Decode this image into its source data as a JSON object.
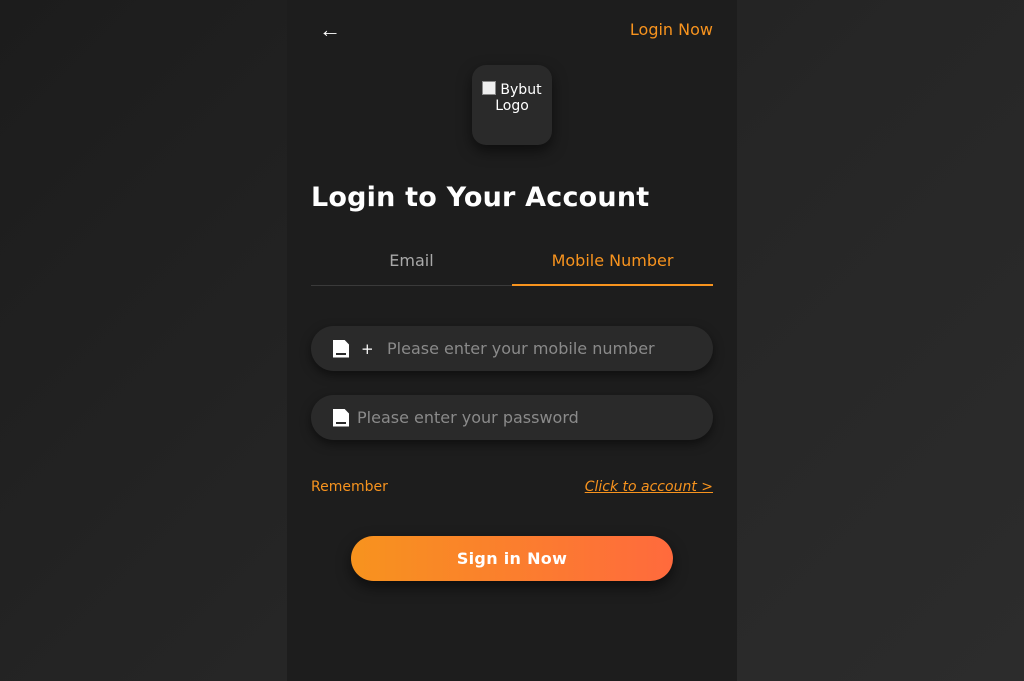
{
  "header": {
    "back_icon": "←",
    "login_now_label": "Login Now"
  },
  "logo": {
    "alt_text": "Bybut Logo"
  },
  "title": "Login to Your Account",
  "tabs": [
    {
      "label": "Email",
      "active": false
    },
    {
      "label": "Mobile Number",
      "active": true
    }
  ],
  "phone_field": {
    "icon": "flag-icon",
    "prefix": "+",
    "value": "",
    "placeholder": "Please enter your mobile number"
  },
  "password_field": {
    "icon": "lock-icon",
    "value": "",
    "placeholder": "Please enter your password"
  },
  "links": {
    "remember_label": "Remember",
    "click_account_label": "Click to account >"
  },
  "sign_in_label": "Sign in Now",
  "colors": {
    "accent": "#f7931e",
    "accent_end": "#ff6a3d",
    "panel": "#1d1d1d",
    "field_bg": "#2a2a2a"
  }
}
